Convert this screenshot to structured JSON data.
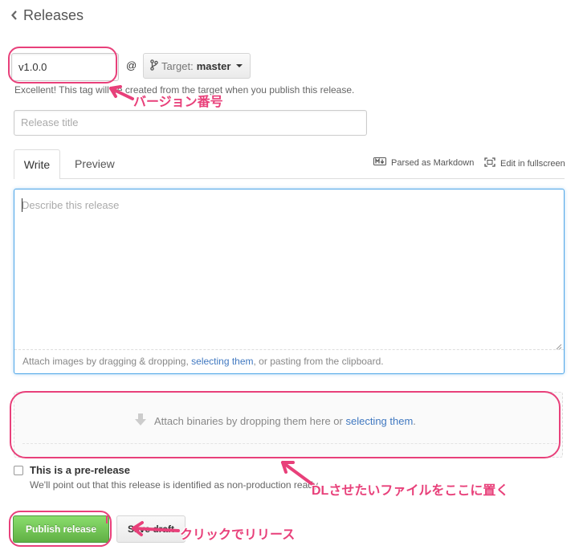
{
  "header": {
    "back_label": "Releases"
  },
  "tag": {
    "value": "v1.0.0",
    "at_symbol": "@",
    "target_prefix": "Target:",
    "target_branch": "master",
    "hint": "Excellent! This tag will be created from the target when you publish this release."
  },
  "title_field": {
    "placeholder": "Release title"
  },
  "tabs": [
    {
      "label": "Write",
      "active": true
    },
    {
      "label": "Preview",
      "active": false
    }
  ],
  "toolbar": {
    "markdown_label": "Parsed as Markdown",
    "fullscreen_label": "Edit in fullscreen"
  },
  "editor": {
    "placeholder": "Describe this release",
    "attach_prefix": "Attach images by dragging & dropping, ",
    "attach_link": "selecting them",
    "attach_suffix": ", or pasting from the clipboard."
  },
  "binaries": {
    "prefix": "Attach binaries by dropping them here or ",
    "link": "selecting them",
    "suffix": "."
  },
  "prerelease": {
    "label": "This is a pre-release",
    "checked": false,
    "description": "We'll point out that this release is identified as non-production ready."
  },
  "buttons": {
    "publish": "Publish release",
    "draft": "Save draft"
  },
  "annotations": {
    "version": "バージョン番号",
    "files": "DLさせたいファイルをここに置く",
    "click": "クリックでリリース"
  },
  "colors": {
    "accent": "#e8407a",
    "publish_green": "#60b044",
    "link": "#4078c0",
    "focus": "#51a7e8"
  },
  "icons": {
    "back": "chevron-left-icon",
    "branch": "git-branch-icon",
    "markdown": "markdown-icon",
    "fullscreen": "fullscreen-icon",
    "upload": "arrow-down-icon"
  }
}
